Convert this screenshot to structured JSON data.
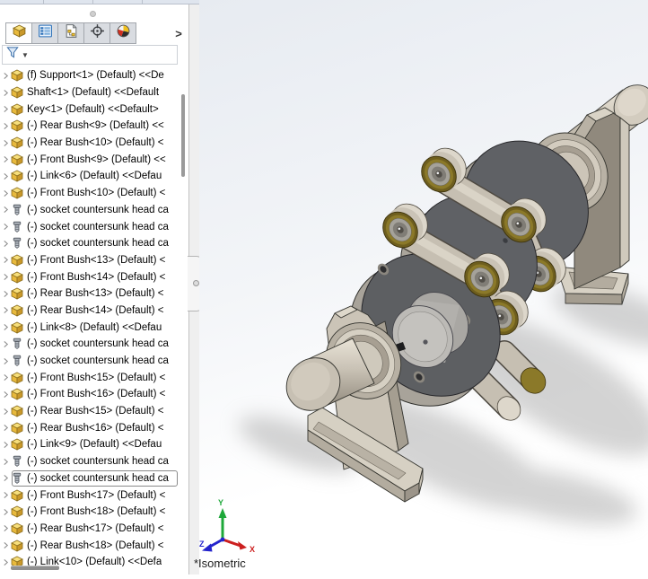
{
  "panel": {
    "tabs": [
      {
        "icon": "featuremanager-cube-icon",
        "active": true
      },
      {
        "icon": "propertymanager-list-icon",
        "active": false
      },
      {
        "icon": "configurationmanager-sheet-icon",
        "active": false
      },
      {
        "icon": "dimxpertmanager-crosshair-icon",
        "active": false
      },
      {
        "icon": "displaymanager-colorwheel-icon",
        "active": false
      }
    ],
    "tab_overflow": ">",
    "filter_icon": "filter-funnel-icon",
    "tree_items": [
      {
        "type": "part",
        "label": "(f) Support<1> (Default) <<De"
      },
      {
        "type": "part",
        "label": "Shaft<1> (Default) <<Default"
      },
      {
        "type": "part",
        "label": "Key<1> (Default) <<Default>"
      },
      {
        "type": "part",
        "label": "(-) Rear Bush<9> (Default) <<"
      },
      {
        "type": "part",
        "label": "(-) Rear Bush<10> (Default) <"
      },
      {
        "type": "part",
        "label": "(-) Front Bush<9> (Default) <<"
      },
      {
        "type": "part",
        "label": "(-) Link<6> (Default) <<Defau"
      },
      {
        "type": "part",
        "label": "(-) Front Bush<10> (Default) <"
      },
      {
        "type": "screw",
        "label": "(-) socket countersunk head ca"
      },
      {
        "type": "screw",
        "label": "(-) socket countersunk head ca"
      },
      {
        "type": "screw",
        "label": "(-) socket countersunk head ca"
      },
      {
        "type": "part",
        "label": "(-) Front Bush<13> (Default) <"
      },
      {
        "type": "part",
        "label": "(-) Front Bush<14> (Default) <"
      },
      {
        "type": "part",
        "label": "(-) Rear Bush<13> (Default) <"
      },
      {
        "type": "part",
        "label": "(-) Rear Bush<14> (Default) <"
      },
      {
        "type": "part",
        "label": "(-) Link<8> (Default) <<Defau"
      },
      {
        "type": "screw",
        "label": "(-) socket countersunk head ca"
      },
      {
        "type": "screw",
        "label": "(-) socket countersunk head ca"
      },
      {
        "type": "part",
        "label": "(-) Front Bush<15> (Default) <"
      },
      {
        "type": "part",
        "label": "(-) Front Bush<16> (Default) <"
      },
      {
        "type": "part",
        "label": "(-) Rear Bush<15> (Default) <"
      },
      {
        "type": "part",
        "label": "(-) Rear Bush<16> (Default) <"
      },
      {
        "type": "part",
        "label": "(-) Link<9> (Default) <<Defau"
      },
      {
        "type": "screw",
        "label": "(-) socket countersunk head ca"
      },
      {
        "type": "screw",
        "label": "(-) socket countersunk head ca",
        "selected": true
      },
      {
        "type": "part",
        "label": "(-) Front Bush<17> (Default) <"
      },
      {
        "type": "part",
        "label": "(-) Front Bush<18> (Default) <"
      },
      {
        "type": "part",
        "label": "(-) Rear Bush<17> (Default) <"
      },
      {
        "type": "part",
        "label": "(-) Rear Bush<18> (Default) <"
      },
      {
        "type": "part",
        "label": "(-) Link<10> (Default) <<Defa"
      }
    ]
  },
  "viewport": {
    "view_label": "*Isometric",
    "triad": {
      "x": {
        "label": "X",
        "color": "#cc1f1f"
      },
      "y": {
        "label": "Y",
        "color": "#1ea83a"
      },
      "z": {
        "label": "Z",
        "color": "#2424cc"
      }
    }
  },
  "colors": {
    "selection_border": "#8a8a8a",
    "part_icon_gold": "#e8b93c",
    "brass_bush": "#8a7828",
    "support_beige": "#cbc4b7",
    "disc_gray": "#5f6165",
    "viewport_top": "#e7ebf1"
  }
}
